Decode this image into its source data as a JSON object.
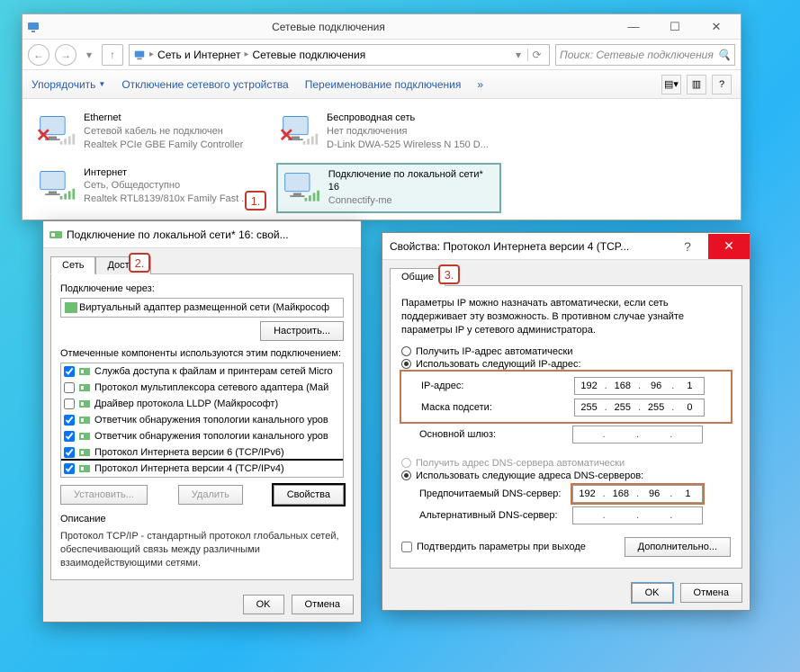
{
  "mainWindow": {
    "title": "Сетевые подключения",
    "breadcrumb": {
      "icon": "network-icon",
      "seg1": "Сеть и Интернет",
      "seg2": "Сетевые подключения"
    },
    "searchPlaceholder": "Поиск: Сетевые подключения",
    "cmdbar": {
      "organize": "Упорядочить",
      "disable": "Отключение сетевого устройства",
      "rename": "Переименование подключения"
    },
    "connections": [
      {
        "title": "Ethernet",
        "sub1": "Сетевой кабель не подключен",
        "sub2": "Realtek PCIe GBE Family Controller",
        "state": "cable-off"
      },
      {
        "title": "Беспроводная сеть",
        "sub1": "Нет подключения",
        "sub2": "D-Link DWA-525 Wireless N 150 D...",
        "state": "wifi-off"
      },
      {
        "title": "Интернет",
        "sub1": "Сеть, Общедоступно",
        "sub2": "Realtek RTL8139/810x Family Fast ...",
        "state": "on"
      },
      {
        "title": "Подключение по локальной сети* 16",
        "sub1": "Connectify-me",
        "sub2": "",
        "state": "on",
        "selected": true
      }
    ]
  },
  "propsDialog": {
    "title": "Подключение по локальной сети* 16: свой...",
    "tabs": {
      "network": "Сеть",
      "access": "Доступ"
    },
    "labels": {
      "connectUsing": "Подключение через:",
      "adapter": "Виртуальный адаптер размещенной сети (Майкрософ",
      "configure": "Настроить...",
      "componentsCaption": "Отмеченные компоненты используются этим подключением:",
      "install": "Установить...",
      "remove": "Удалить",
      "properties": "Свойства",
      "descHeader": "Описание",
      "descText": "Протокол TCP/IP - стандартный протокол глобальных сетей, обеспечивающий связь между различными взаимодействующими сетями.",
      "ok": "OK",
      "cancel": "Отмена"
    },
    "components": [
      {
        "checked": true,
        "label": "Служба доступа к файлам и принтерам сетей Micro"
      },
      {
        "checked": false,
        "label": "Протокол мультиплексора сетевого адаптера (Май"
      },
      {
        "checked": false,
        "label": "Драйвер протокола LLDP (Майкрософт)"
      },
      {
        "checked": true,
        "label": "Ответчик обнаружения топологии канального уров"
      },
      {
        "checked": true,
        "label": "Ответчик обнаружения топологии канального уров"
      },
      {
        "checked": true,
        "label": "Протокол Интернета версии 6 (TCP/IPv6)"
      },
      {
        "checked": true,
        "label": "Протокол Интернета версии 4 (TCP/IPv4)",
        "highlighted": true
      }
    ]
  },
  "ipDialog": {
    "title": "Свойства: Протокол Интернета версии 4 (TCP...",
    "tab": "Общие",
    "intro": "Параметры IP можно назначать автоматически, если сеть поддерживает эту возможность. В противном случае узнайте параметры IP у сетевого администратора.",
    "radioAutoIp": "Получить IP-адрес автоматически",
    "radioUseIp": "Использовать следующий IP-адрес:",
    "ipLabel": "IP-адрес:",
    "ipValue": [
      "192",
      "168",
      "96",
      "1"
    ],
    "maskLabel": "Маска подсети:",
    "maskValue": [
      "255",
      "255",
      "255",
      "0"
    ],
    "gwLabel": "Основной шлюз:",
    "gwValue": [
      "",
      "",
      "",
      ""
    ],
    "radioAutoDns": "Получить адрес DNS-сервера автоматически",
    "radioUseDns": "Использовать следующие адреса DNS-серверов:",
    "dns1Label": "Предпочитаемый DNS-сервер:",
    "dns1Value": [
      "192",
      "168",
      "96",
      "1"
    ],
    "dns2Label": "Альтернативный DNS-сервер:",
    "dns2Value": [
      "",
      "",
      "",
      ""
    ],
    "validateCheck": "Подтвердить параметры при выходе",
    "advanced": "Дополнительно...",
    "ok": "OK",
    "cancel": "Отмена"
  },
  "markers": {
    "m1": "1.",
    "m2": "2.",
    "m3": "3."
  }
}
